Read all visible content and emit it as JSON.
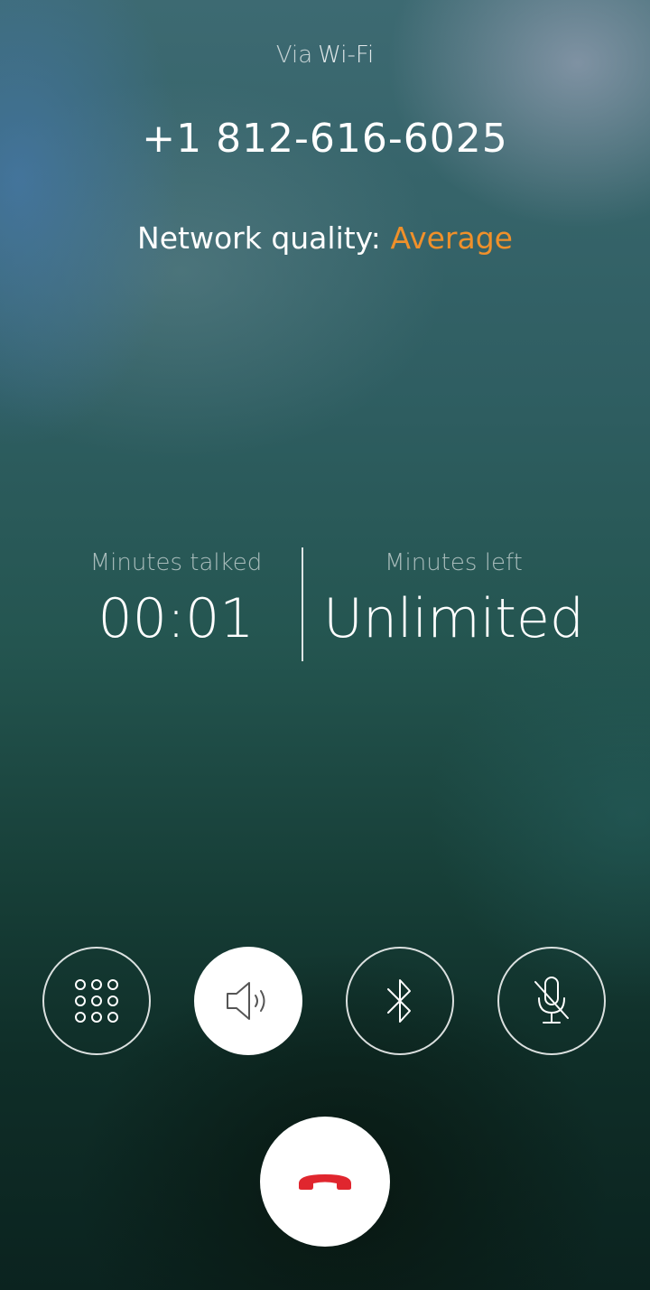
{
  "connection": {
    "via_label": "Via",
    "network_type": "Wi-Fi"
  },
  "call": {
    "phone_number": "+1 812-616-6025",
    "network_quality_label": "Network quality:",
    "network_quality_value": "Average"
  },
  "stats": {
    "talked_label": "Minutes talked",
    "talked_value": "00:01",
    "left_label": "Minutes left",
    "left_value": "Unlimited"
  },
  "controls": [
    {
      "name": "keypad",
      "icon": "keypad-icon",
      "active": false
    },
    {
      "name": "speaker",
      "icon": "speaker-icon",
      "active": true
    },
    {
      "name": "bluetooth",
      "icon": "bluetooth-icon",
      "active": false
    },
    {
      "name": "mute",
      "icon": "mic-off-icon",
      "active": false
    }
  ],
  "end_call": {
    "icon": "hangup-phone-icon"
  },
  "colors": {
    "quality_accent": "#f0902a",
    "hangup_red": "#e0262e"
  }
}
